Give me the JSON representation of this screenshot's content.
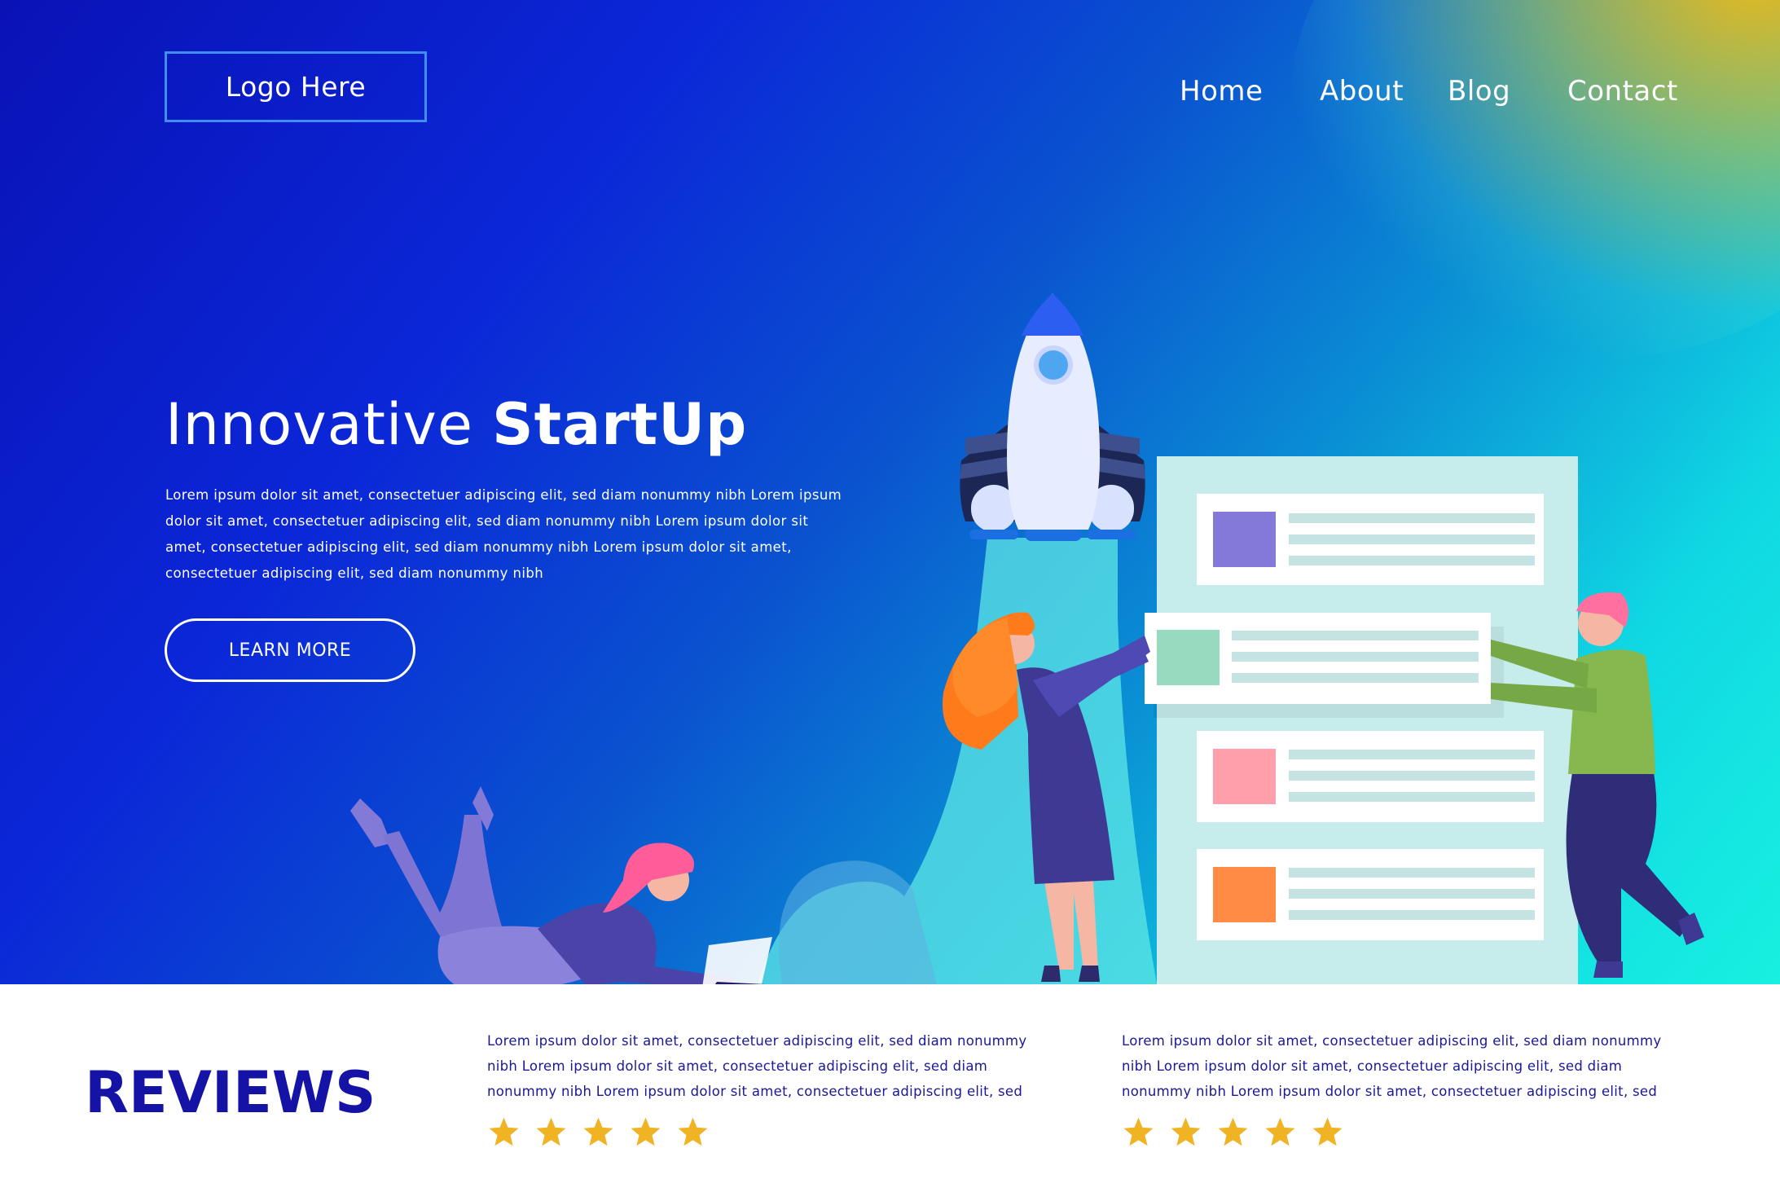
{
  "header": {
    "logo_text": "Logo Here",
    "nav": {
      "home": "Home",
      "about": "About",
      "blog": "Blog",
      "contact": "Contact"
    }
  },
  "hero": {
    "title_light": "Innovative ",
    "title_bold": "StartUp",
    "body": "Lorem ipsum dolor sit amet, consectetuer adipiscing elit, sed diam nonummy nibh Lorem ipsum dolor sit amet, consectetuer adipiscing elit, sed diam nonummy nibh Lorem ipsum dolor sit amet, consectetuer adipiscing elit, sed diam nonummy nibh Lorem ipsum dolor sit amet, consectetuer adipiscing elit, sed diam nonummy nibh",
    "cta_label": "LEARN MORE"
  },
  "reviews": {
    "heading": "REVIEWS",
    "items": [
      {
        "text": "Lorem ipsum dolor sit amet, consectetuer adipiscing elit, sed diam nonummy nibh Lorem ipsum dolor sit amet, consectetuer adipiscing elit, sed diam nonummy nibh Lorem ipsum dolor sit amet, consectetuer adipiscing elit, sed",
        "rating": 5
      },
      {
        "text": "Lorem ipsum dolor sit amet, consectetuer adipiscing elit, sed diam nonummy nibh Lorem ipsum dolor sit amet, consectetuer adipiscing elit, sed diam nonummy nibh Lorem ipsum dolor sit amet, consectetuer adipiscing elit, sed",
        "rating": 5
      }
    ]
  },
  "colors": {
    "hero_dark_blue": "#0a12b6",
    "hero_cyan": "#18f0e0",
    "hero_gold": "#f7ba0f",
    "reviews_blue": "#1413a6",
    "star_gold": "#f0b323",
    "card_purple": "#8479d9",
    "card_green": "#96dbc0",
    "card_pink": "#ff9fab",
    "card_orange": "#ff8b45"
  },
  "icons": {
    "rating": "star-icon"
  }
}
